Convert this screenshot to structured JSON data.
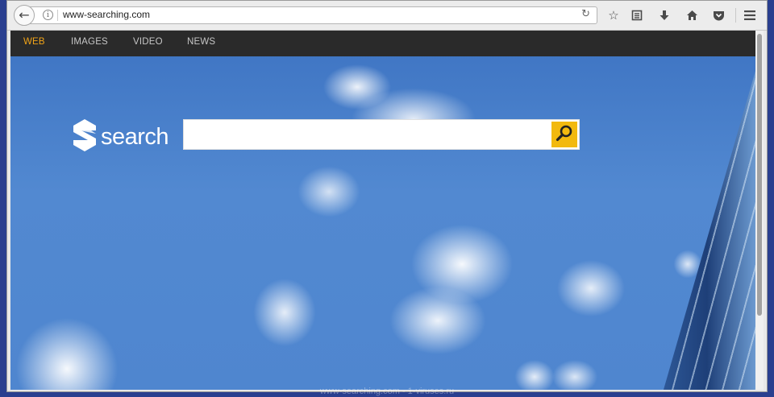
{
  "browser": {
    "url": "www-searching.com",
    "toolbar_icons": [
      "star-icon",
      "reading-list-icon",
      "download-icon",
      "home-icon",
      "pocket-icon",
      "menu-icon"
    ]
  },
  "nav": {
    "items": [
      {
        "label": "WEB",
        "active": true
      },
      {
        "label": "IMAGES",
        "active": false
      },
      {
        "label": "VIDEO",
        "active": false
      },
      {
        "label": "NEWS",
        "active": false
      }
    ]
  },
  "logo": {
    "text": "search"
  },
  "search": {
    "value": "",
    "placeholder": ""
  },
  "watermark": "www-searching.com - 1-viruses.ru",
  "colors": {
    "accent": "#f2b90f",
    "nav_active": "#f0a318",
    "navbar_bg": "#2a2a2a"
  }
}
